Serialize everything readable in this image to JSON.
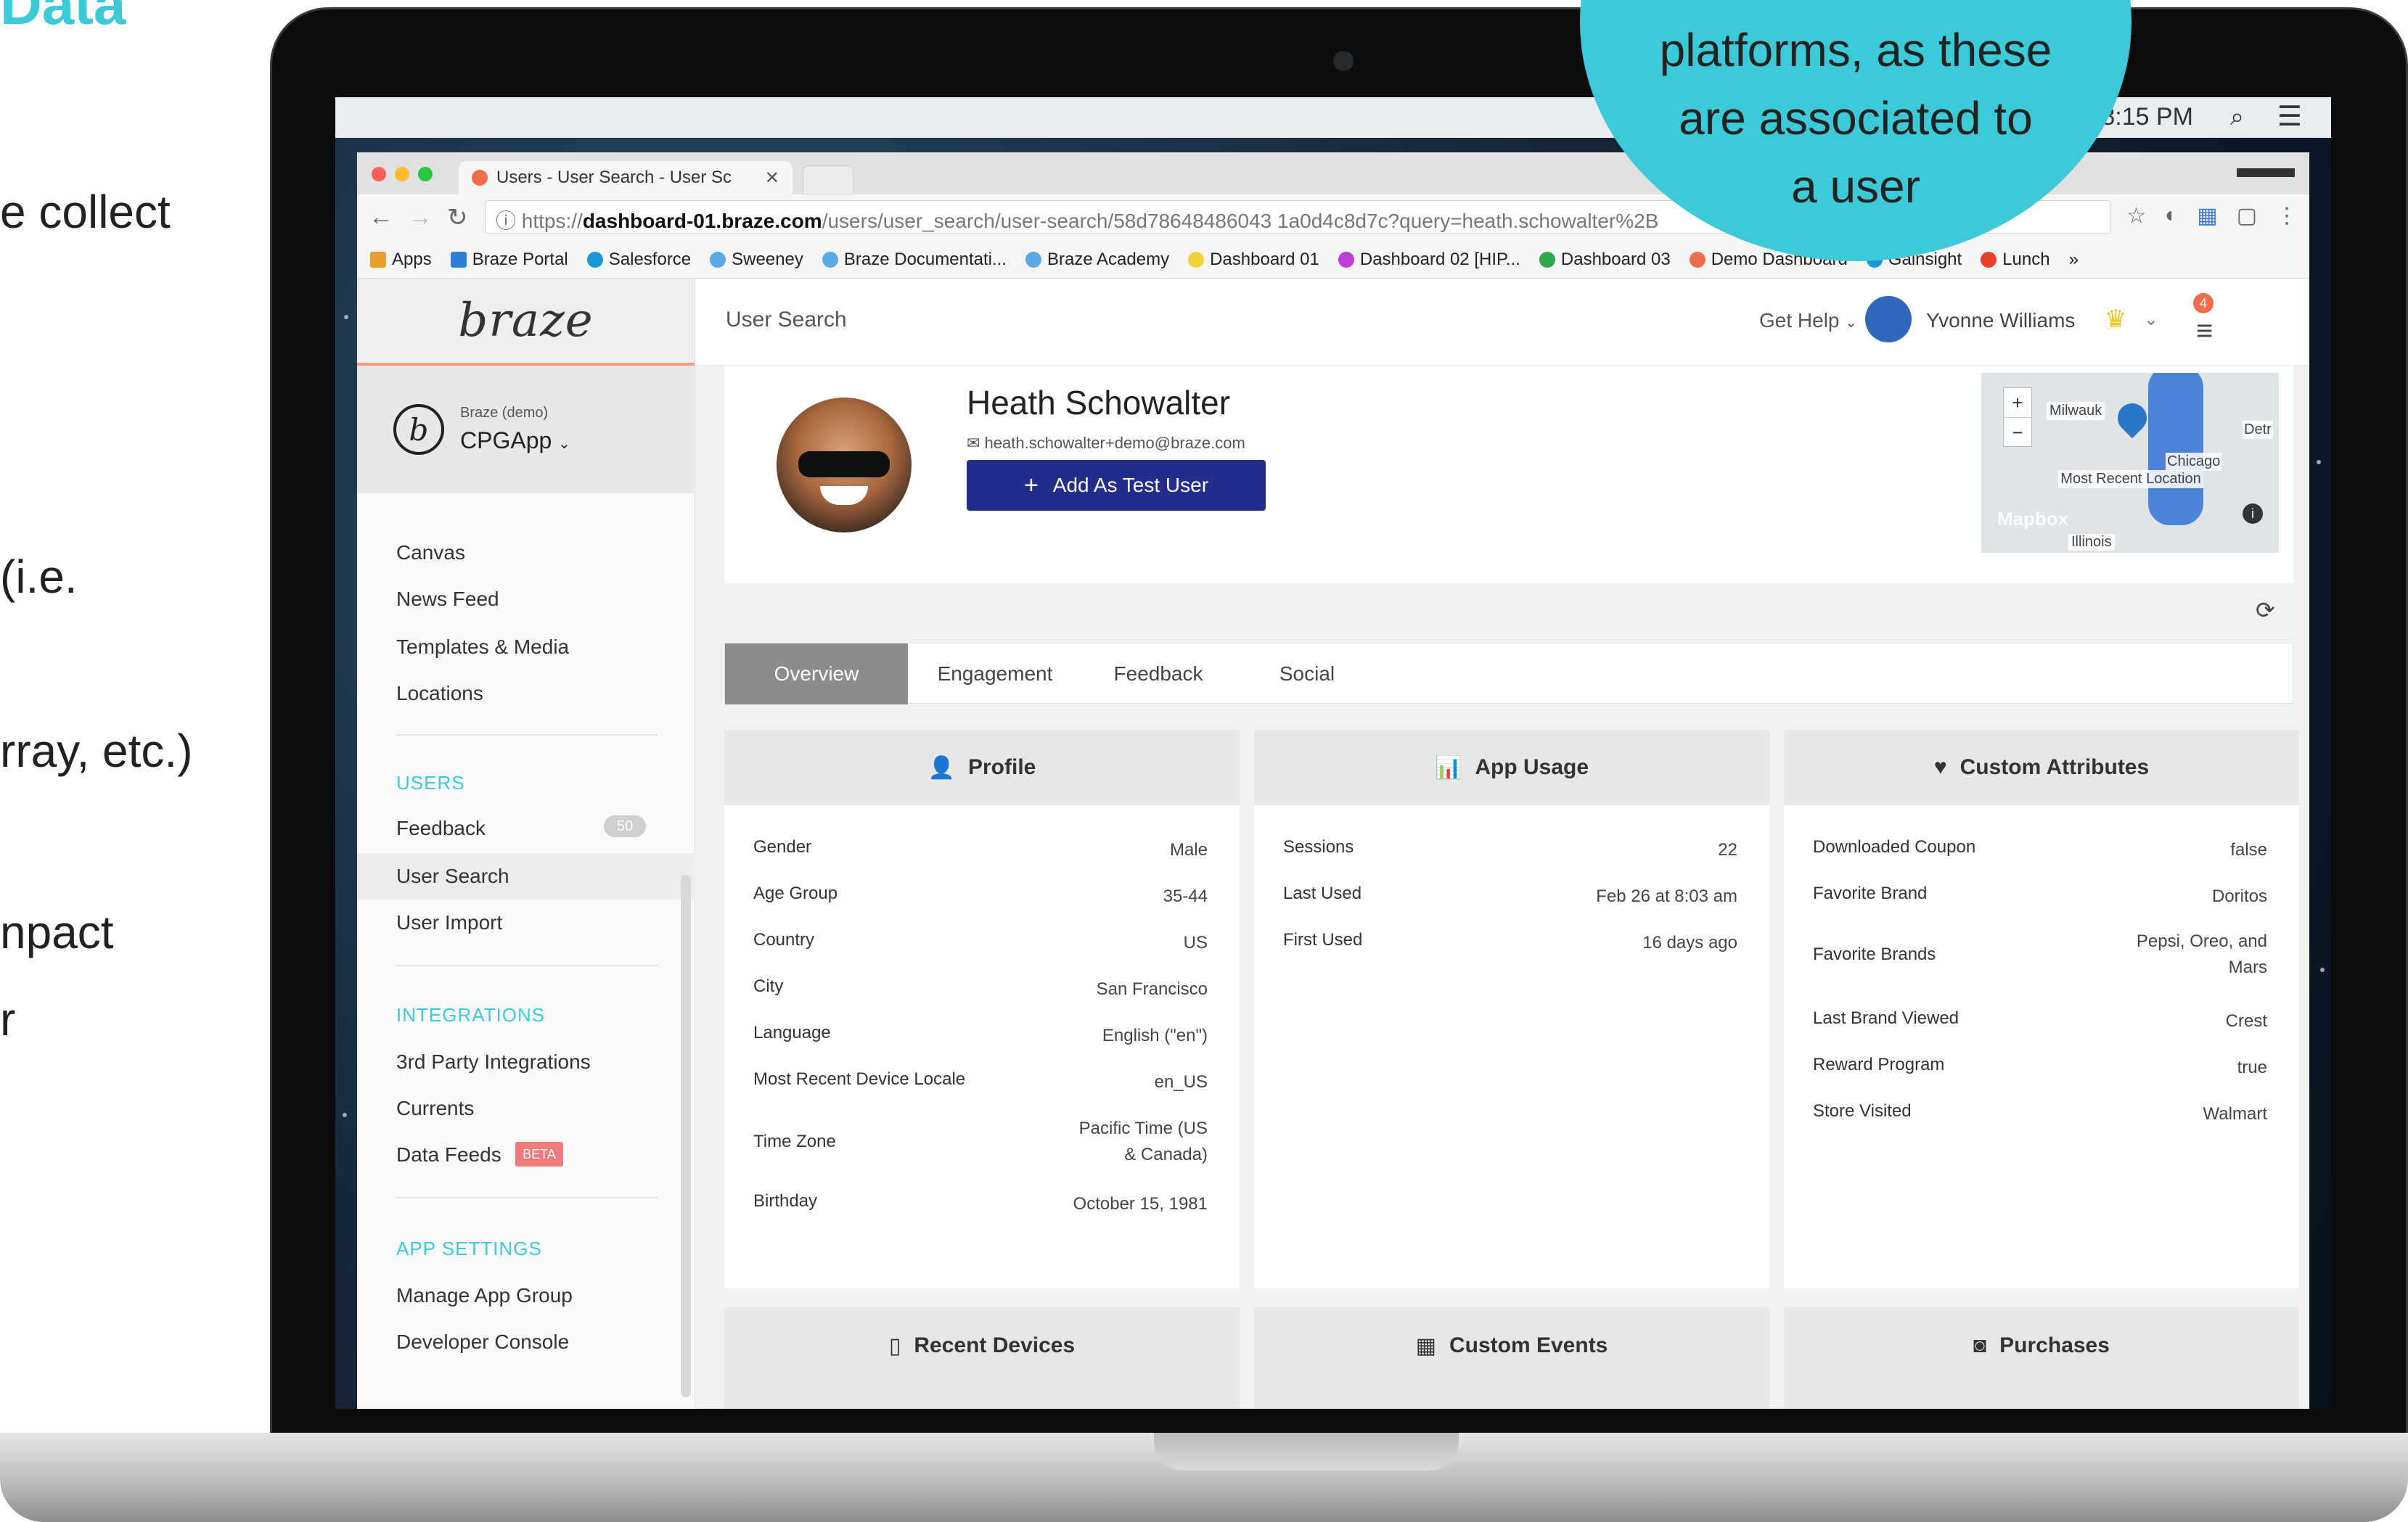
{
  "slide": {
    "heading": "Data",
    "fragments": [
      "e collect",
      "(i.e.",
      "rray, etc.)",
      "npact",
      "r"
    ],
    "bubble_lines": [
      "platforms, as these",
      "are associated to",
      "a user"
    ]
  },
  "mac": {
    "clock": "8:15 PM"
  },
  "browser": {
    "tab_title": "Users - User Search - User Sc",
    "url_prefix": "https://",
    "url_host": "dashboard-01.braze.com",
    "url_path": "/users/user_search/user-search/58d78648486043 1a0d4c8d7c?query=heath.schowalter%2B",
    "bookmarks": [
      "Apps",
      "Braze Portal",
      "Salesforce",
      "Sweeney",
      "Braze Documentati...",
      "Braze Academy",
      "Dashboard 01",
      "Dashboard 02 [HIP...",
      "Dashboard 03",
      "Demo Dashboard",
      "Gainsight",
      "Lunch"
    ]
  },
  "sidebar": {
    "logo": "braze",
    "app_group": "Braze (demo)",
    "app_name": "CPGApp",
    "items": [
      "Canvas",
      "News Feed",
      "Templates & Media",
      "Locations"
    ],
    "users_section": "USERS",
    "users_items": [
      "Feedback",
      "User Search",
      "User Import"
    ],
    "feedback_count": "50",
    "integrations_section": "INTEGRATIONS",
    "integrations_items": [
      "3rd Party Integrations",
      "Currents",
      "Data Feeds"
    ],
    "beta_label": "BETA",
    "app_settings_section": "APP SETTINGS",
    "app_settings_items": [
      "Manage App Group",
      "Developer Console"
    ]
  },
  "topbar": {
    "crumb": "User Search",
    "help": "Get Help",
    "user_name": "Yvonne Williams",
    "notif_count": "4"
  },
  "profile": {
    "name": "Heath Schowalter",
    "email": "heath.schowalter+demo@braze.com",
    "add_test_label": "Add As Test User",
    "map_labels": {
      "milwaukee": "Milwauk",
      "detroit": "Detr",
      "chicago": "Chicago",
      "recent": "Most Recent Location",
      "illinois": "Illinois",
      "mapbox": "Mapbox"
    }
  },
  "tabs": [
    "Overview",
    "Engagement",
    "Feedback",
    "Social"
  ],
  "cards": {
    "profile_title": "Profile",
    "profile_rows": [
      {
        "k": "Gender",
        "v": "Male"
      },
      {
        "k": "Age Group",
        "v": "35-44"
      },
      {
        "k": "Country",
        "v": "US"
      },
      {
        "k": "City",
        "v": "San Francisco"
      },
      {
        "k": "Language",
        "v": "English (\"en\")"
      },
      {
        "k": "Most Recent Device Locale",
        "v": "en_US"
      },
      {
        "k": "Time Zone",
        "v": "Pacific Time (US & Canada)"
      },
      {
        "k": "Birthday",
        "v": "October 15, 1981"
      }
    ],
    "usage_title": "App Usage",
    "usage_rows": [
      {
        "k": "Sessions",
        "v": "22"
      },
      {
        "k": "Last Used",
        "v": "Feb 26 at 8:03 am"
      },
      {
        "k": "First Used",
        "v": "16 days ago"
      }
    ],
    "custom_title": "Custom Attributes",
    "custom_rows": [
      {
        "k": "Downloaded Coupon",
        "v": "false"
      },
      {
        "k": "Favorite Brand",
        "v": "Doritos"
      },
      {
        "k": "Favorite Brands",
        "v": "Pepsi, Oreo, and Mars"
      },
      {
        "k": "Last Brand Viewed",
        "v": "Crest"
      },
      {
        "k": "Reward Program",
        "v": "true"
      },
      {
        "k": "Store Visited",
        "v": "Walmart"
      }
    ],
    "recent_devices": "Recent Devices",
    "custom_events": "Custom Events",
    "purchases": "Purchases"
  },
  "colors": {
    "accent": "#3ccad9",
    "button": "#232d8c",
    "beta": "#f07a7a",
    "crown": "#f2c21b"
  }
}
